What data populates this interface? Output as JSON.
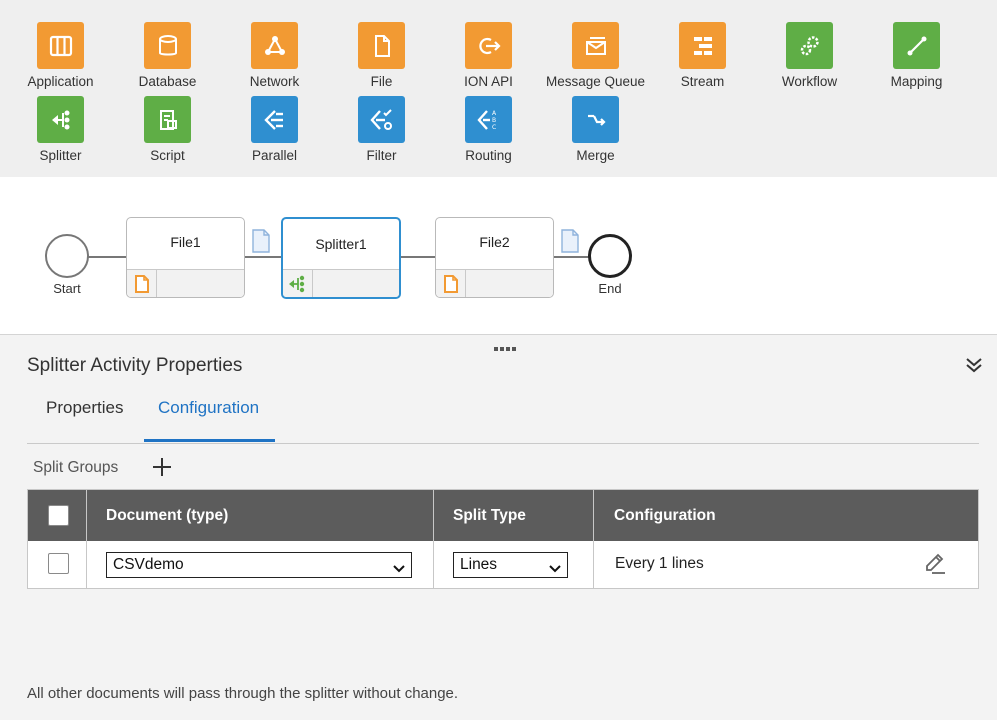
{
  "palette": {
    "items": [
      {
        "label": "Application",
        "icon": "application-icon",
        "color": "#f29a33"
      },
      {
        "label": "Database",
        "icon": "database-icon",
        "color": "#f29a33"
      },
      {
        "label": "Network",
        "icon": "network-icon",
        "color": "#f29a33"
      },
      {
        "label": "File",
        "icon": "file-icon",
        "color": "#f29a33"
      },
      {
        "label": "ION API",
        "icon": "ion-api-icon",
        "color": "#f29a33"
      },
      {
        "label": "Message Queue",
        "icon": "message-queue-icon",
        "color": "#f29a33"
      },
      {
        "label": "Stream",
        "icon": "stream-icon",
        "color": "#f29a33"
      },
      {
        "label": "Workflow",
        "icon": "workflow-icon",
        "color": "#5fae46"
      },
      {
        "label": "Mapping",
        "icon": "mapping-icon",
        "color": "#5fae46"
      },
      {
        "label": "Splitter",
        "icon": "splitter-icon",
        "color": "#5fae46"
      },
      {
        "label": "Script",
        "icon": "script-icon",
        "color": "#5fae46"
      },
      {
        "label": "Parallel",
        "icon": "parallel-icon",
        "color": "#2f8fd0"
      },
      {
        "label": "Filter",
        "icon": "filter-icon",
        "color": "#2f8fd0"
      },
      {
        "label": "Routing",
        "icon": "routing-icon",
        "color": "#2f8fd0"
      },
      {
        "label": "Merge",
        "icon": "merge-icon",
        "color": "#2f8fd0"
      }
    ]
  },
  "flow": {
    "start_label": "Start",
    "end_label": "End",
    "activities": [
      {
        "title": "File1",
        "icon": "file-icon",
        "selected": false
      },
      {
        "title": "Splitter1",
        "icon": "splitter-icon",
        "selected": true
      },
      {
        "title": "File2",
        "icon": "file-icon",
        "selected": false
      }
    ]
  },
  "panel": {
    "title": "Splitter Activity Properties",
    "tabs": [
      {
        "label": "Properties",
        "active": false
      },
      {
        "label": "Configuration",
        "active": true
      }
    ],
    "split_groups_label": "Split Groups",
    "table": {
      "headers": [
        "Document (type)",
        "Split Type",
        "Configuration"
      ],
      "rows": [
        {
          "document": "CSVdemo",
          "split_type": "Lines",
          "configuration": "Every 1 lines"
        }
      ]
    },
    "footer_note": "All other documents will pass through the splitter without change."
  },
  "colors": {
    "orange": "#f29a33",
    "green": "#5fae46",
    "blue": "#2f8fd0",
    "accent": "#1f73c4",
    "header": "#5c5c5c"
  }
}
